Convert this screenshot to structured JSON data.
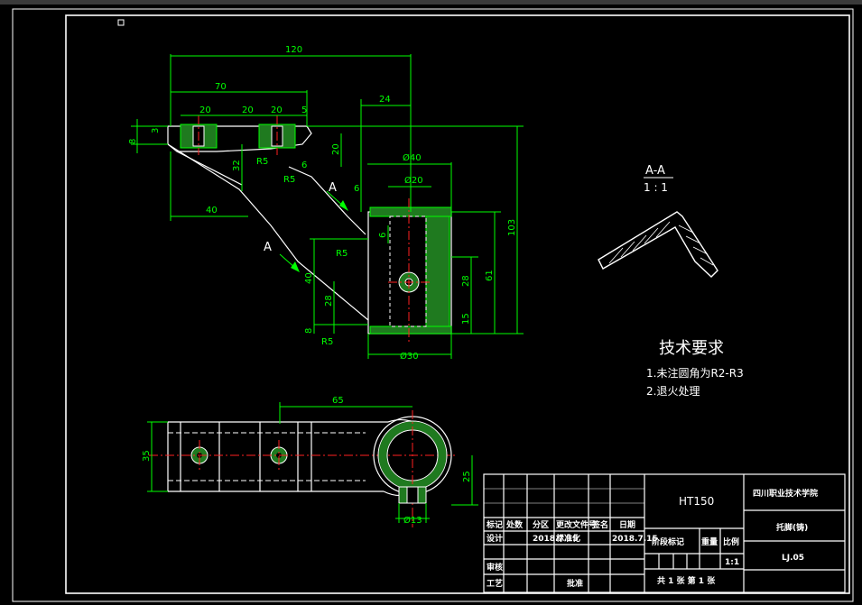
{
  "section_view": {
    "label": "A-A",
    "scale": "1 : 1"
  },
  "section_marker": "A",
  "tech_requirements": {
    "title": "技术要求",
    "items": [
      "1.未注圆角为R2-R3",
      "2.退火处理"
    ]
  },
  "dimensions": {
    "d120": "120",
    "d70": "70",
    "d24": "24",
    "d20a": "20",
    "d20b": "20",
    "d20c": "20",
    "d5": "5",
    "d8a": "8",
    "d3": "3",
    "d20v": "20",
    "d32": "32",
    "d6a": "6",
    "r5a": "R5",
    "r5b": "R5",
    "r5c": "R5",
    "r5d": "R5",
    "d6b": "6",
    "d6c": "6",
    "d40h": "40",
    "d40v": "40",
    "phi40": "Ø40",
    "phi20": "Ø20",
    "d103": "103",
    "d61": "61",
    "d28a": "28",
    "d28b": "28",
    "d15": "15",
    "d8b": "8",
    "phi30": "Ø30",
    "d65": "65",
    "d35": "35",
    "d25": "25",
    "phi13": "Ø13"
  },
  "title_block": {
    "material": "HT150",
    "school": "四川职业技术学院",
    "part_name": "托脚(铸)",
    "drawing_no": "LJ.05",
    "scale_value": "1:1",
    "sheets": "共 1 张  第 1 张",
    "headers": {
      "mark": "标记",
      "count": "处数",
      "zone": "分区",
      "doc": "更改文件号",
      "sign": "签名",
      "date": "日期",
      "design": "设计",
      "review": "审核",
      "process": "工艺",
      "approve": "批准",
      "stage": "阶段标记",
      "weight": "重量",
      "scale": "比例"
    },
    "design_date": "2018.7.15",
    "designer": "标准化",
    "std_date": "2018.7.15"
  }
}
